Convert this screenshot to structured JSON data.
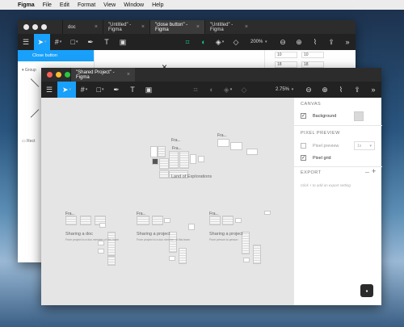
{
  "menubar": {
    "apple": "",
    "app": "Figma",
    "items": [
      "File",
      "Edit",
      "Format",
      "View",
      "Window",
      "Help"
    ]
  },
  "back_window": {
    "tabs": [
      {
        "label": "doc"
      },
      {
        "label": "\"Untitled\" - Figma"
      },
      {
        "label": "\"close button\" - Figma"
      },
      {
        "label": "\"Untitled\" - Figma"
      }
    ],
    "zoom": "200%",
    "layer_selected": "Close button",
    "layer_group": "Group",
    "layer_rect": "Rect",
    "inputs": [
      "10",
      "10",
      "18",
      "18"
    ]
  },
  "front_window": {
    "title": "\"Shared Project\" - Figma",
    "zoom": "2.75%",
    "canvas": {
      "group_labels": [
        "Land of Explorations",
        "Sharing a doc",
        "Sharing a project",
        "Sharing a project"
      ],
      "group_sublabels": [
        "From project to a doc member of this team",
        "From project to a doc member of this team",
        "From person to person"
      ],
      "frame_label": "Fra..."
    },
    "panel": {
      "canvas_header": "CANVAS",
      "background_label": "Background",
      "background_color": "#d9d9d9",
      "pixel_header": "PIXEL PREVIEW",
      "pixel_preview_label": "Pixel preview",
      "pixel_preview_value": "1x",
      "pixel_grid_label": "Pixel grid",
      "export_header": "EXPORT",
      "export_hint": "Click + to add an export setting",
      "export_add": "+"
    }
  },
  "colors": {
    "accent": "#18a0fb",
    "toolbar": "#222222",
    "close": "#ff5f57",
    "minimize": "#febc2e",
    "maximize": "#28c840"
  }
}
